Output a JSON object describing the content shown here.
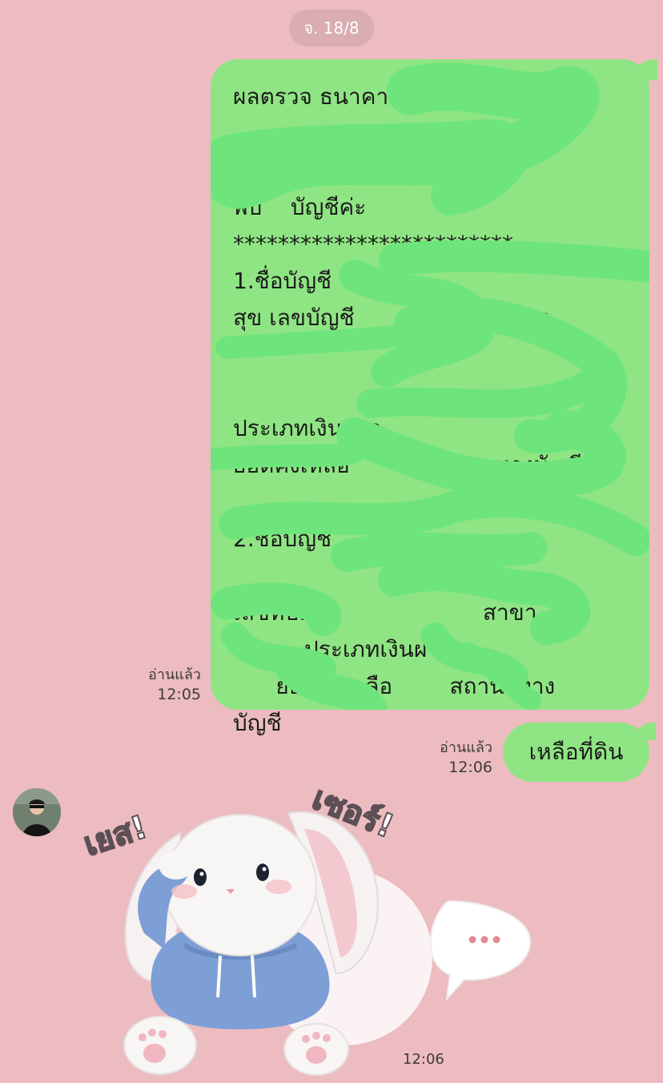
{
  "date_separator": "จ. 18/8",
  "message_long": {
    "lines": [
      "ผลตรวจ ธนาคาร",
      "",
      "",
      "พบ    บัญชีค่ะ",
      "*************************",
      "1.ชื่อบัญชี",
      "สุข เลขบัญชี                    สาขา",
      "",
      "",
      "ประเภทเงินฝาก",
      "ยอดคงเหลือ           สถานะทางบัญชี",
      "",
      "2.ชื่อบัญชี",
      "",
      "เลขที่บัญชี                     สาขา",
      "          ประเภทเงินฝาก",
      "      ยอดคงเหลือ        สถานะทาง",
      "บัญชี"
    ],
    "read_label": "อ่านแล้ว",
    "time": "12:05"
  },
  "message_short": {
    "text": "เหลือที่ดิน",
    "read_label": "อ่านแล้ว",
    "time": "12:06"
  },
  "sticker": {
    "text_left": "เยส!",
    "text_right": "เซอร์!",
    "time": "12:06"
  },
  "colors": {
    "background": "#ecbcc0",
    "bubble": "#8fe583",
    "scribble": "#6ee57c"
  }
}
